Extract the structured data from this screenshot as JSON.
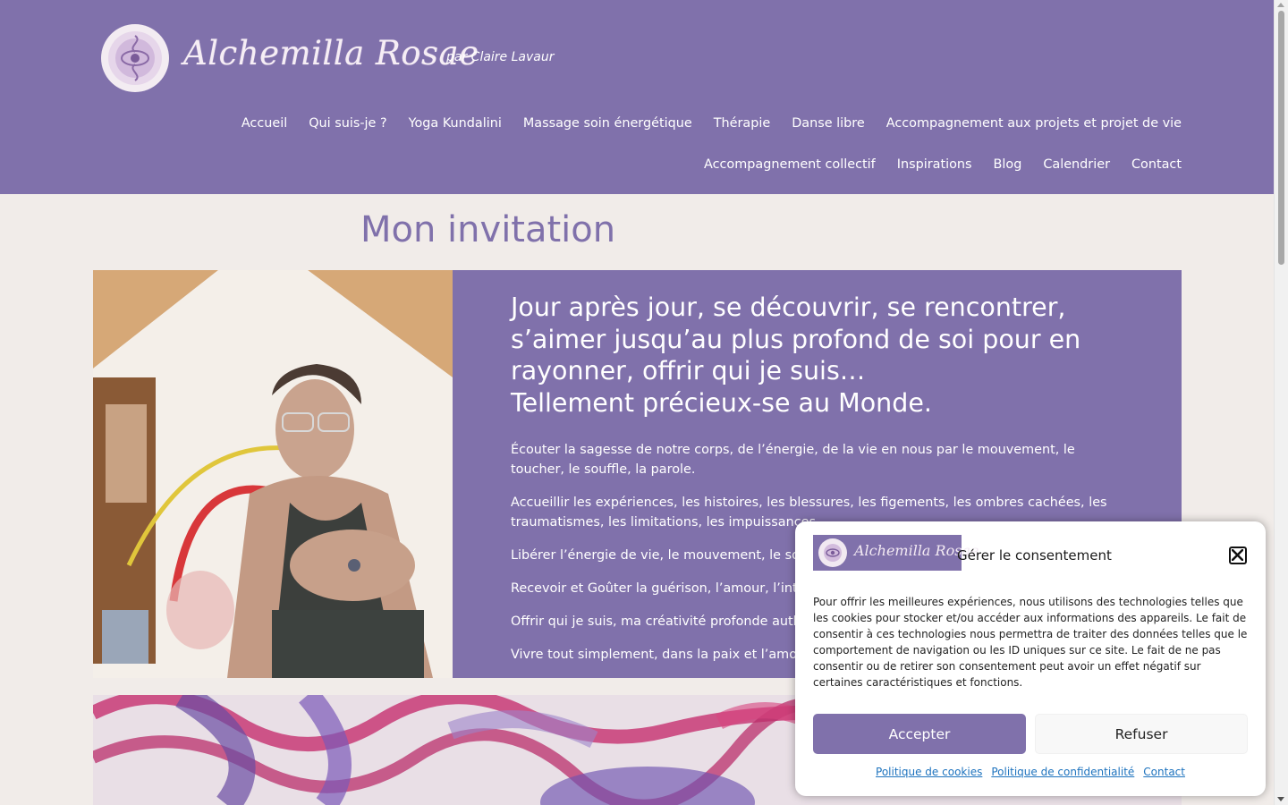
{
  "header": {
    "brand_name": "Alchemilla Rosae",
    "tagline": "par Claire Lavaur",
    "nav_row1": [
      "Accueil",
      "Qui suis-je ?",
      "Yoga Kundalini",
      "Massage soin énergétique",
      "Thérapie",
      "Danse libre",
      "Accompagnement aux projets et projet de vie"
    ],
    "nav_row2": [
      "Accompagnement collectif",
      "Inspirations",
      "Blog",
      "Calendrier",
      "Contact"
    ]
  },
  "main": {
    "title": "Mon invitation",
    "hero_heading": [
      "Jour après jour, se découvrir, se rencontrer,",
      "s’aimer jusqu’au plus profond de soi pour en",
      "rayonner, offrir qui je suis…",
      "Tellement précieux-se au Monde."
    ],
    "paragraphs": [
      "Écouter la sagesse de notre corps, de l’énergie, de la vie en nous par le mouvement, le toucher, le souffle, la parole.",
      "Accueillir les expériences, les histoires, les blessures, les figements, les ombres cachées, les traumatismes, les limitations, les impuissances.",
      "Libérer l’énergie de vie, le mouvement, le souffl",
      "Recevoir et Goûter la guérison, l’amour, l’intellig",
      "Offrir qui je suis, ma créativité profonde authen",
      "Vivre tout simplement, dans la paix et l’amour, p"
    ]
  },
  "cookie": {
    "logo_text": "Alchemilla Rosae",
    "title": "Gérer le consentement",
    "body": "Pour offrir les meilleures expériences, nous utilisons des technologies telles que les cookies pour stocker et/ou accéder aux informations des appareils. Le fait de consentir à ces technologies nous permettra de traiter des données telles que le comportement de navigation ou les ID uniques sur ce site. Le fait de ne pas consentir ou de retirer son consentement peut avoir un effet négatif sur certaines caractéristiques et fonctions.",
    "accept": "Accepter",
    "refuse": "Refuser",
    "links": [
      "Politique de cookies",
      "Politique de confidentialité",
      "Contact"
    ]
  },
  "colors": {
    "brand_purple": "#8071ab",
    "page_background": "#f1ece9",
    "link_blue": "#1e73be"
  },
  "icons": [
    "brand-logo-icon",
    "close-icon"
  ]
}
